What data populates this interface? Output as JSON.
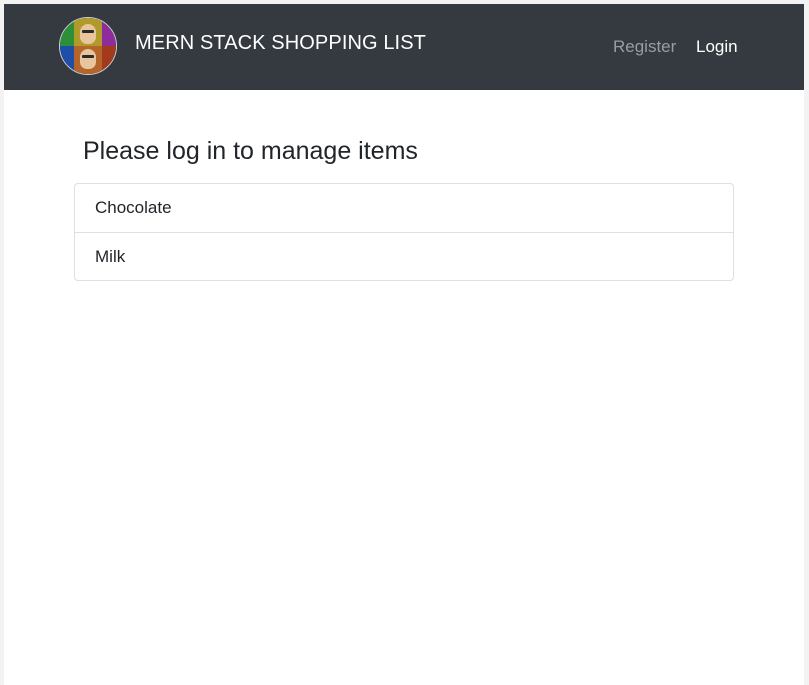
{
  "navbar": {
    "brand_title": "MERN STACK SHOPPING LIST",
    "links": [
      {
        "label": "Register"
      },
      {
        "label": "Login"
      }
    ],
    "colors": {
      "background": "#343a40",
      "link_muted": "#9a9da0",
      "link_active": "#ffffff"
    }
  },
  "main": {
    "heading": "Please log in to manage items",
    "items": [
      {
        "name": "Chocolate"
      },
      {
        "name": "Milk"
      }
    ]
  }
}
